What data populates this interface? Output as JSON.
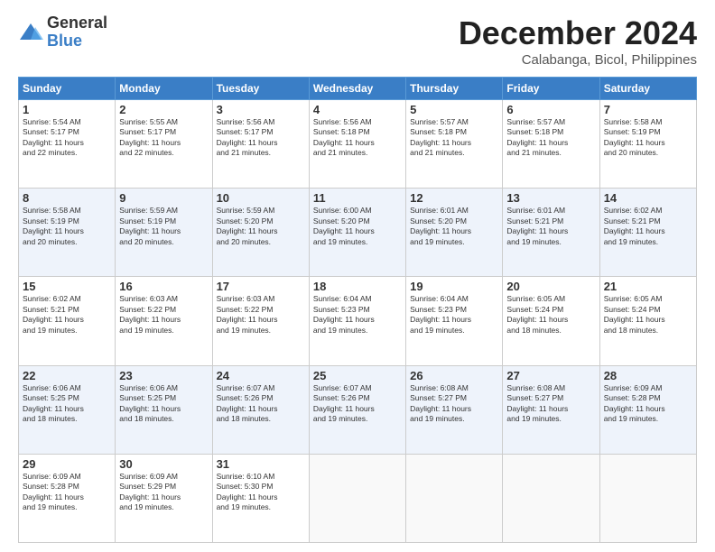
{
  "logo": {
    "general": "General",
    "blue": "Blue"
  },
  "title": "December 2024",
  "subtitle": "Calabanga, Bicol, Philippines",
  "headers": [
    "Sunday",
    "Monday",
    "Tuesday",
    "Wednesday",
    "Thursday",
    "Friday",
    "Saturday"
  ],
  "weeks": [
    [
      {
        "day": "1",
        "sunrise": "5:54 AM",
        "sunset": "5:17 PM",
        "daylight": "11 hours and 22 minutes."
      },
      {
        "day": "2",
        "sunrise": "5:55 AM",
        "sunset": "5:17 PM",
        "daylight": "11 hours and 22 minutes."
      },
      {
        "day": "3",
        "sunrise": "5:56 AM",
        "sunset": "5:17 PM",
        "daylight": "11 hours and 21 minutes."
      },
      {
        "day": "4",
        "sunrise": "5:56 AM",
        "sunset": "5:18 PM",
        "daylight": "11 hours and 21 minutes."
      },
      {
        "day": "5",
        "sunrise": "5:57 AM",
        "sunset": "5:18 PM",
        "daylight": "11 hours and 21 minutes."
      },
      {
        "day": "6",
        "sunrise": "5:57 AM",
        "sunset": "5:18 PM",
        "daylight": "11 hours and 21 minutes."
      },
      {
        "day": "7",
        "sunrise": "5:58 AM",
        "sunset": "5:19 PM",
        "daylight": "11 hours and 20 minutes."
      }
    ],
    [
      {
        "day": "8",
        "sunrise": "5:58 AM",
        "sunset": "5:19 PM",
        "daylight": "11 hours and 20 minutes."
      },
      {
        "day": "9",
        "sunrise": "5:59 AM",
        "sunset": "5:19 PM",
        "daylight": "11 hours and 20 minutes."
      },
      {
        "day": "10",
        "sunrise": "5:59 AM",
        "sunset": "5:20 PM",
        "daylight": "11 hours and 20 minutes."
      },
      {
        "day": "11",
        "sunrise": "6:00 AM",
        "sunset": "5:20 PM",
        "daylight": "11 hours and 19 minutes."
      },
      {
        "day": "12",
        "sunrise": "6:01 AM",
        "sunset": "5:20 PM",
        "daylight": "11 hours and 19 minutes."
      },
      {
        "day": "13",
        "sunrise": "6:01 AM",
        "sunset": "5:21 PM",
        "daylight": "11 hours and 19 minutes."
      },
      {
        "day": "14",
        "sunrise": "6:02 AM",
        "sunset": "5:21 PM",
        "daylight": "11 hours and 19 minutes."
      }
    ],
    [
      {
        "day": "15",
        "sunrise": "6:02 AM",
        "sunset": "5:21 PM",
        "daylight": "11 hours and 19 minutes."
      },
      {
        "day": "16",
        "sunrise": "6:03 AM",
        "sunset": "5:22 PM",
        "daylight": "11 hours and 19 minutes."
      },
      {
        "day": "17",
        "sunrise": "6:03 AM",
        "sunset": "5:22 PM",
        "daylight": "11 hours and 19 minutes."
      },
      {
        "day": "18",
        "sunrise": "6:04 AM",
        "sunset": "5:23 PM",
        "daylight": "11 hours and 19 minutes."
      },
      {
        "day": "19",
        "sunrise": "6:04 AM",
        "sunset": "5:23 PM",
        "daylight": "11 hours and 19 minutes."
      },
      {
        "day": "20",
        "sunrise": "6:05 AM",
        "sunset": "5:24 PM",
        "daylight": "11 hours and 18 minutes."
      },
      {
        "day": "21",
        "sunrise": "6:05 AM",
        "sunset": "5:24 PM",
        "daylight": "11 hours and 18 minutes."
      }
    ],
    [
      {
        "day": "22",
        "sunrise": "6:06 AM",
        "sunset": "5:25 PM",
        "daylight": "11 hours and 18 minutes."
      },
      {
        "day": "23",
        "sunrise": "6:06 AM",
        "sunset": "5:25 PM",
        "daylight": "11 hours and 18 minutes."
      },
      {
        "day": "24",
        "sunrise": "6:07 AM",
        "sunset": "5:26 PM",
        "daylight": "11 hours and 18 minutes."
      },
      {
        "day": "25",
        "sunrise": "6:07 AM",
        "sunset": "5:26 PM",
        "daylight": "11 hours and 19 minutes."
      },
      {
        "day": "26",
        "sunrise": "6:08 AM",
        "sunset": "5:27 PM",
        "daylight": "11 hours and 19 minutes."
      },
      {
        "day": "27",
        "sunrise": "6:08 AM",
        "sunset": "5:27 PM",
        "daylight": "11 hours and 19 minutes."
      },
      {
        "day": "28",
        "sunrise": "6:09 AM",
        "sunset": "5:28 PM",
        "daylight": "11 hours and 19 minutes."
      }
    ],
    [
      {
        "day": "29",
        "sunrise": "6:09 AM",
        "sunset": "5:28 PM",
        "daylight": "11 hours and 19 minutes."
      },
      {
        "day": "30",
        "sunrise": "6:09 AM",
        "sunset": "5:29 PM",
        "daylight": "11 hours and 19 minutes."
      },
      {
        "day": "31",
        "sunrise": "6:10 AM",
        "sunset": "5:30 PM",
        "daylight": "11 hours and 19 minutes."
      },
      null,
      null,
      null,
      null
    ]
  ],
  "labels": {
    "sunrise": "Sunrise:",
    "sunset": "Sunset:",
    "daylight": "Daylight:"
  }
}
